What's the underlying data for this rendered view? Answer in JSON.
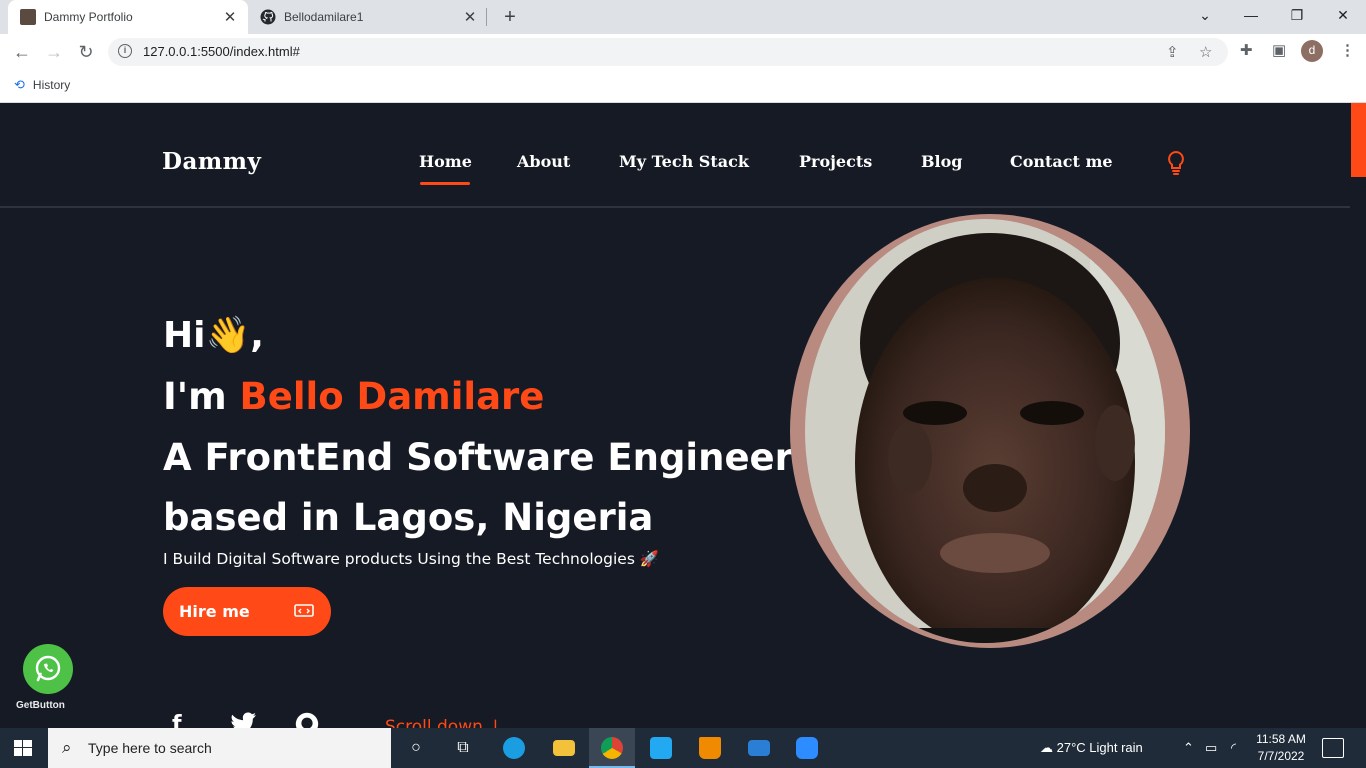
{
  "browser": {
    "tabs": [
      {
        "title": "Dammy Portfolio",
        "active": true
      },
      {
        "title": "Bellodamilare1",
        "active": false
      }
    ],
    "new_tab_label": "+",
    "url": "127.0.0.1:5500/index.html#",
    "bookmarks": [
      {
        "label": "History"
      }
    ],
    "profile_initial": "d"
  },
  "site": {
    "brand": "Dammy",
    "nav": [
      {
        "label": "Home",
        "active": true
      },
      {
        "label": "About"
      },
      {
        "label": "My Tech Stack"
      },
      {
        "label": "Projects"
      },
      {
        "label": "Blog"
      },
      {
        "label": "Contact me"
      }
    ],
    "hero": {
      "greeting": "Hi👋,",
      "intro_prefix": "I'm ",
      "name": "Bello Damilare",
      "role": "A FrontEnd Software Engineer",
      "location": "based in Lagos, Nigeria",
      "subtitle": "I Build Digital Software products Using the Best Technologies 🚀",
      "cta_label": "Hire me"
    },
    "social": [
      "f",
      "twitter",
      "github"
    ],
    "scroll_label": "Scroll down",
    "whatsapp_widget_label": "GetButton",
    "accent_color": "#ff4a17",
    "background_color": "#161a24"
  },
  "taskbar": {
    "search_placeholder": "Type here to search",
    "weather": "27°C  Light rain",
    "time": "11:58 AM",
    "date": "7/7/2022"
  }
}
